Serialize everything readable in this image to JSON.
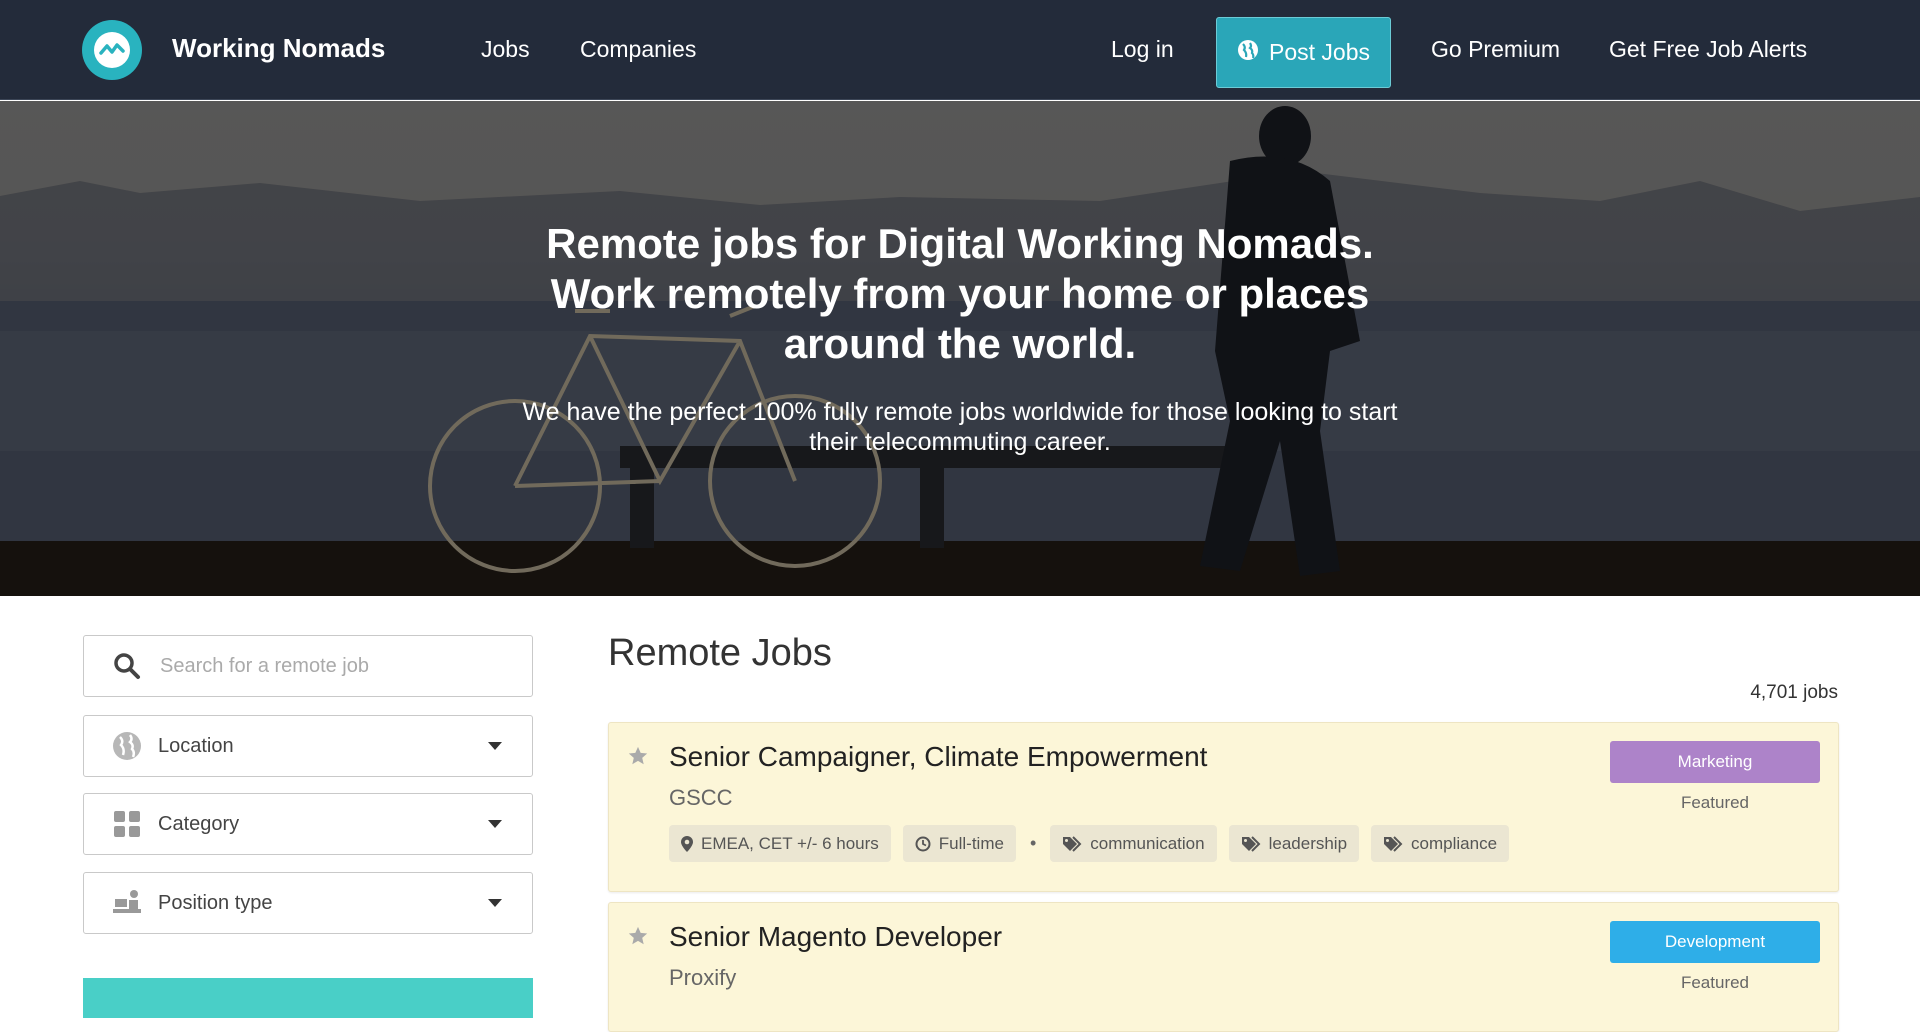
{
  "nav": {
    "brand": "Working Nomads",
    "jobs": "Jobs",
    "companies": "Companies",
    "login": "Log in",
    "post_jobs": "Post Jobs",
    "premium": "Go Premium",
    "alerts": "Get Free Job Alerts"
  },
  "hero": {
    "title": "Remote jobs for Digital Working Nomads. Work remotely from your home or places around the world.",
    "subtitle": "We have the perfect 100% fully remote jobs worldwide for those looking to start their telecommuting career."
  },
  "sidebar": {
    "search_placeholder": "Search for a remote job",
    "location": "Location",
    "category": "Category",
    "position_type": "Position type"
  },
  "main": {
    "title": "Remote Jobs",
    "job_count": "4,701 jobs",
    "jobs": [
      {
        "title": "Senior Campaigner, Climate Empowerment",
        "company": "GSCC",
        "location": "EMEA, CET +/- 6 hours",
        "type": "Full-time",
        "tags": [
          "communication",
          "leadership",
          "compliance"
        ],
        "category": "Marketing",
        "category_color": "#ad83c9",
        "featured": "Featured"
      },
      {
        "title": "Senior Magento Developer",
        "company": "Proxify",
        "category": "Development",
        "category_color": "#2eaee8",
        "featured": "Featured"
      }
    ]
  },
  "colors": {
    "nav_bg": "#232b3a",
    "accent": "#2aa6b8",
    "card_bg": "#fcf6d8"
  }
}
